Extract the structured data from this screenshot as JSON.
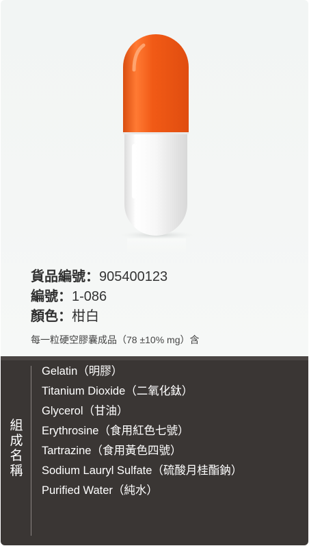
{
  "product": {
    "item_number_label": "貨品編號：",
    "item_number": "905400123",
    "code_label": "編號：",
    "code": "1-086",
    "color_label": "顏色：",
    "color_value": "柑白",
    "note": "每一粒硬空膠囊成品（78 ±10% mg）含"
  },
  "capsule": {
    "cap_color": "#f15a16",
    "body_color": "#ffffff"
  },
  "composition": {
    "title": "組成名稱",
    "items": [
      "Gelatin（明膠）",
      "Titanium Dioxide（二氧化鈦）",
      "Glycerol（甘油）",
      "Erythrosine（食用紅色七號）",
      "Tartrazine（食用黃色四號）",
      "Sodium Lauryl Sulfate（硫酸月桂酯鈉）",
      "Purified Water（純水）"
    ]
  }
}
